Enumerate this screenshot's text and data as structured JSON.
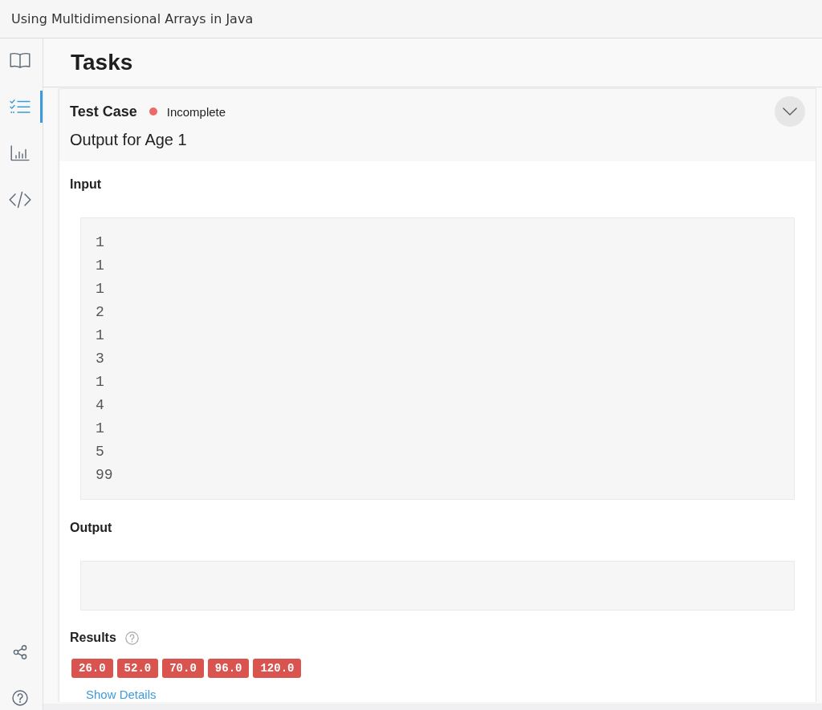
{
  "window": {
    "title": "Using Multidimensional Arrays in Java"
  },
  "sidebar": {
    "items": [
      {
        "kind": "book",
        "selected": false
      },
      {
        "kind": "checklist",
        "selected": true
      },
      {
        "kind": "chart",
        "selected": false
      },
      {
        "kind": "code",
        "selected": false
      }
    ],
    "bottom_items": [
      {
        "kind": "share"
      },
      {
        "kind": "help"
      }
    ]
  },
  "page": {
    "title": "Tasks"
  },
  "test_case": {
    "label": "Test Case",
    "complete": false,
    "status": "Incomplete",
    "title": "Output for Age 1",
    "expanded": true,
    "input": {
      "label": "Input",
      "lines": [
        "1",
        "1",
        "1",
        "2",
        "1",
        "3",
        "1",
        "4",
        "1",
        "5",
        "99"
      ]
    },
    "output": {
      "label": "Output"
    },
    "results": {
      "label": "Results",
      "values": [
        {
          "value": "26.0",
          "passed": false
        },
        {
          "value": "52.0",
          "passed": false
        },
        {
          "value": "70.0",
          "passed": false
        },
        {
          "value": "96.0",
          "passed": false
        },
        {
          "value": "120.0",
          "passed": false
        }
      ]
    },
    "details_link": "Show Details"
  }
}
